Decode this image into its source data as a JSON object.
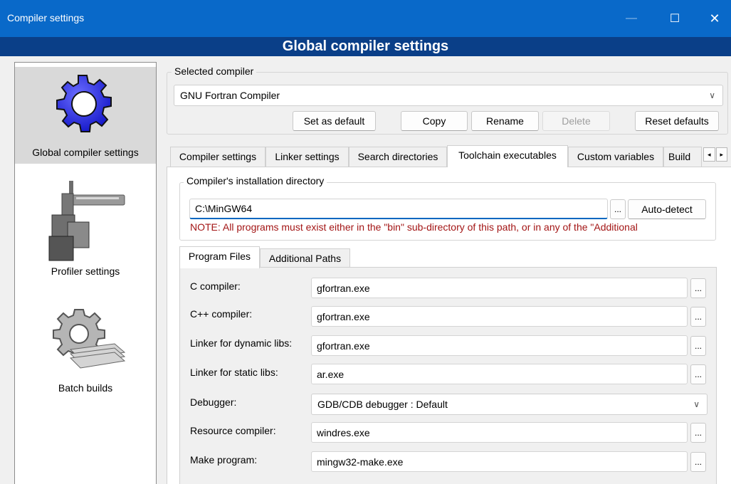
{
  "window": {
    "title": "Compiler settings",
    "minimize_glyph": "—",
    "maximize_glyph": "☐",
    "close_glyph": "✕"
  },
  "header": {
    "title": "Global compiler settings"
  },
  "sidebar": {
    "items": [
      {
        "label": "Global compiler settings",
        "icon": "gear-icon",
        "selected": true
      },
      {
        "label": "Profiler settings",
        "icon": "caliper-icon",
        "selected": false
      },
      {
        "label": "Batch builds",
        "icon": "gear-stack-icon",
        "selected": false
      }
    ]
  },
  "compiler_group": {
    "title": "Selected compiler",
    "selected_value": "GNU Fortran Compiler",
    "buttons": {
      "set_default": "Set as default",
      "copy": "Copy",
      "rename": "Rename",
      "delete": "Delete",
      "reset": "Reset defaults"
    }
  },
  "tabs": [
    {
      "label": "Compiler settings",
      "active": false
    },
    {
      "label": "Linker settings",
      "active": false
    },
    {
      "label": "Search directories",
      "active": false
    },
    {
      "label": "Toolchain executables",
      "active": true
    },
    {
      "label": "Custom variables",
      "active": false
    },
    {
      "label": "Build",
      "active": false
    }
  ],
  "tab_scroll": {
    "left": "◂",
    "right": "▸"
  },
  "install_dir": {
    "title": "Compiler's installation directory",
    "value": "C:\\MinGW64",
    "browse": "...",
    "autodetect": "Auto-detect",
    "note": "NOTE: All programs must exist either in the \"bin\" sub-directory of this path, or in any of the \"Additional"
  },
  "subtabs": [
    {
      "label": "Program Files",
      "active": true
    },
    {
      "label": "Additional Paths",
      "active": false
    }
  ],
  "programs": {
    "browse": "...",
    "rows": [
      {
        "label": "C compiler:",
        "value": "gfortran.exe"
      },
      {
        "label": "C++ compiler:",
        "value": "gfortran.exe"
      },
      {
        "label": "Linker for dynamic libs:",
        "value": "gfortran.exe"
      },
      {
        "label": "Linker for static libs:",
        "value": "ar.exe"
      },
      {
        "label": "Debugger:",
        "value": "GDB/CDB debugger : Default"
      },
      {
        "label": "Resource compiler:",
        "value": "windres.exe"
      },
      {
        "label": "Make program:",
        "value": "mingw32-make.exe"
      }
    ]
  },
  "colors": {
    "titlebar": "#0969c9",
    "header": "#0a3f88",
    "note": "#a31515",
    "gear_blue": "#2b2ee0"
  }
}
